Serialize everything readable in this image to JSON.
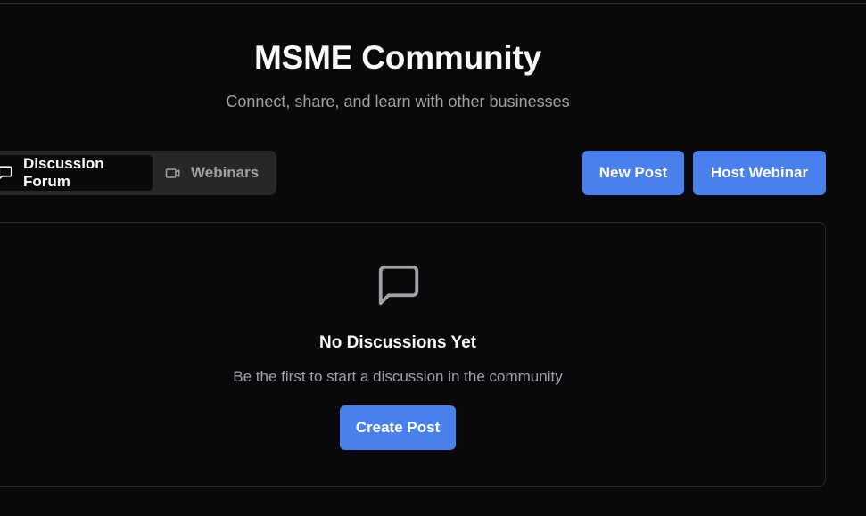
{
  "header": {
    "title": "MSME Community",
    "subtitle": "Connect, share, and learn with other businesses"
  },
  "tabs": [
    {
      "label": "Discussion Forum",
      "icon": "message-square-icon",
      "active": true
    },
    {
      "label": "Webinars",
      "icon": "video-camera-icon",
      "active": false
    }
  ],
  "actions": {
    "new_post": "New Post",
    "host_webinar": "Host Webinar"
  },
  "empty_state": {
    "icon": "message-square-icon",
    "title": "No Discussions Yet",
    "description": "Be the first to start a discussion in the community",
    "button": "Create Post"
  },
  "colors": {
    "background": "#09090b",
    "accent": "#4a80ec",
    "muted_text": "#a1a1aa",
    "border": "#27272a"
  }
}
